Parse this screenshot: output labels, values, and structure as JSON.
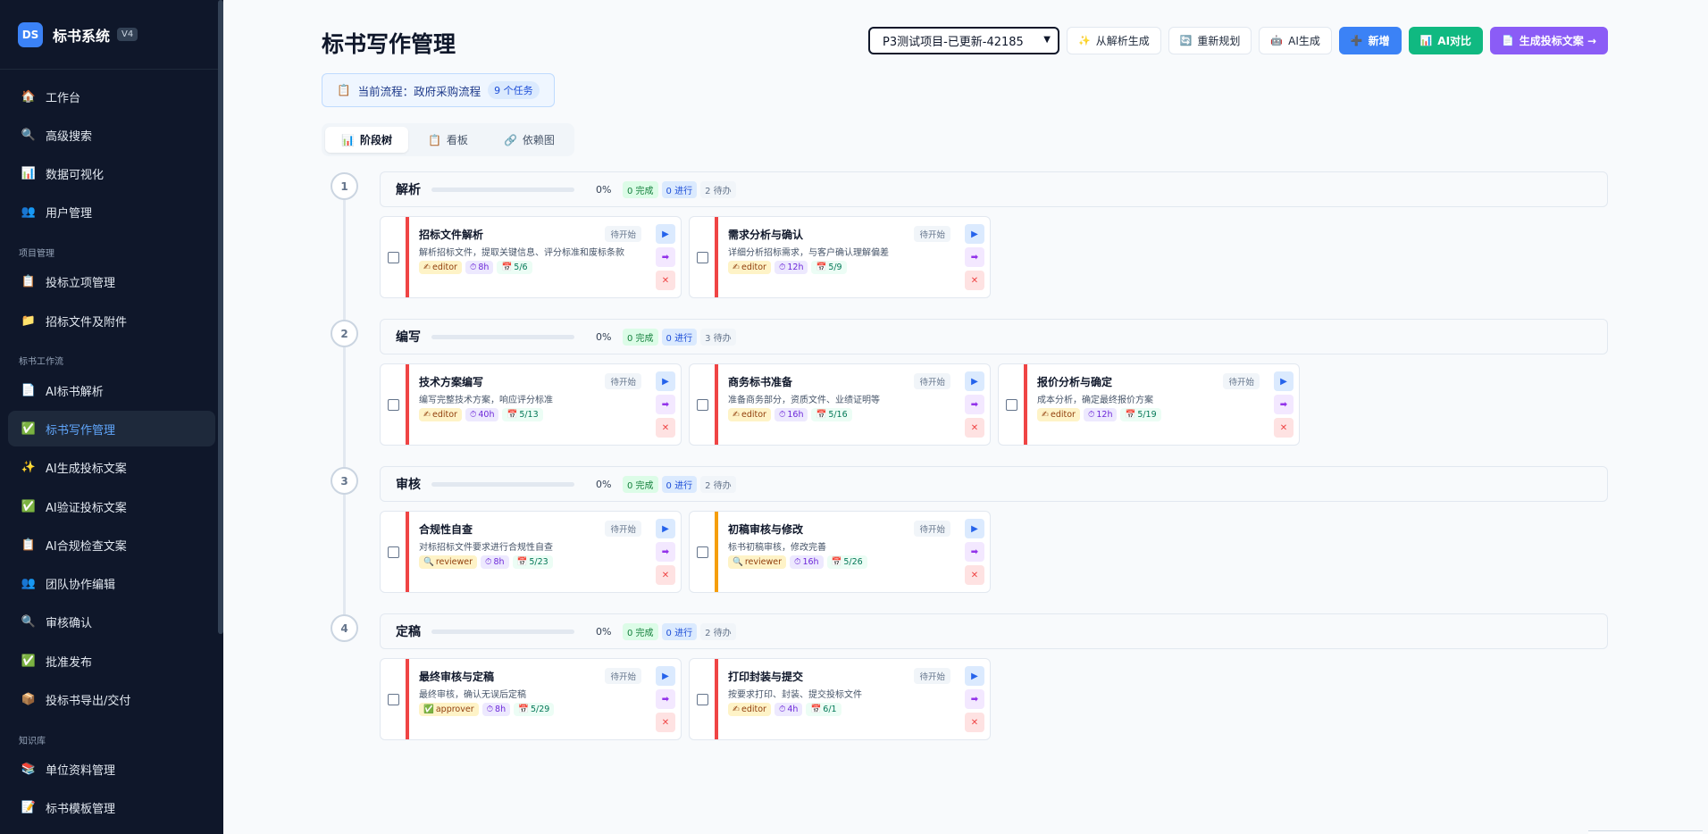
{
  "brand": {
    "logo": "DS",
    "title": "标书系统",
    "version": "V4"
  },
  "sidebar": {
    "groups": [
      {
        "label": "",
        "items": [
          {
            "label": "工作台",
            "icon": "house-icon",
            "glyph": "🏠",
            "active": false
          },
          {
            "label": "高级搜索",
            "icon": "search-icon",
            "glyph": "🔍",
            "active": false
          },
          {
            "label": "数据可视化",
            "icon": "chart-icon",
            "glyph": "📊",
            "active": false
          },
          {
            "label": "用户管理",
            "icon": "users-icon",
            "glyph": "👥",
            "active": false
          }
        ]
      },
      {
        "label": "项目管理",
        "items": [
          {
            "label": "投标立项管理",
            "icon": "clipboard-icon",
            "glyph": "📋",
            "active": false
          },
          {
            "label": "招标文件及附件",
            "icon": "folder-icon",
            "glyph": "📁",
            "active": false
          }
        ]
      },
      {
        "label": "标书工作流",
        "items": [
          {
            "label": "AI标书解析",
            "icon": "document-icon",
            "glyph": "📄",
            "active": false
          },
          {
            "label": "标书写作管理",
            "icon": "check-icon",
            "glyph": "✅",
            "active": true
          },
          {
            "label": "AI生成投标文案",
            "icon": "sparkles-icon",
            "glyph": "✨",
            "active": false
          },
          {
            "label": "AI验证投标文案",
            "icon": "check-icon",
            "glyph": "✅",
            "active": false
          },
          {
            "label": "AI合规检查文案",
            "icon": "clipboard-icon",
            "glyph": "📋",
            "active": false
          },
          {
            "label": "团队协作编辑",
            "icon": "users-icon",
            "glyph": "👥",
            "active": false
          },
          {
            "label": "审核确认",
            "icon": "search-icon",
            "glyph": "🔍",
            "active": false
          },
          {
            "label": "批准发布",
            "icon": "check-icon",
            "glyph": "✅",
            "active": false
          },
          {
            "label": "投标书导出/交付",
            "icon": "package-icon",
            "glyph": "📦",
            "active": false
          }
        ]
      },
      {
        "label": "知识库",
        "items": [
          {
            "label": "单位资料管理",
            "icon": "books-icon",
            "glyph": "📚",
            "active": false
          },
          {
            "label": "标书模板管理",
            "icon": "template-icon",
            "glyph": "📝",
            "active": false
          }
        ]
      }
    ]
  },
  "page": {
    "title": "标书写作管理"
  },
  "toolbar": {
    "project_value": "P3测试项目-已更新-42185",
    "buttons": [
      {
        "label": "从解析生成",
        "icon": "sparkles-icon",
        "glyph": "✨",
        "style": "plain",
        "name": "generate-from-parse-button"
      },
      {
        "label": "重新规划",
        "icon": "refresh-icon",
        "glyph": "🔄",
        "style": "plain",
        "name": "replan-button"
      },
      {
        "label": "AI生成",
        "icon": "robot-icon",
        "glyph": "🤖",
        "style": "plain",
        "name": "ai-generate-button"
      },
      {
        "label": "新增",
        "icon": "plus-icon",
        "glyph": "➕",
        "style": "blue",
        "name": "add-button"
      },
      {
        "label": "AI对比",
        "icon": "chart-icon",
        "glyph": "📊",
        "style": "green",
        "name": "ai-compare-button"
      },
      {
        "label": "生成投标文案 →",
        "icon": "document-icon",
        "glyph": "📄",
        "style": "purple",
        "name": "generate-bid-text-button"
      }
    ]
  },
  "flow": {
    "prefix": "当前流程：政府采购流程",
    "count": "9 个任务"
  },
  "view_tabs": [
    {
      "label": "阶段树",
      "icon": "chart-icon",
      "glyph": "📊",
      "active": true
    },
    {
      "label": "看板",
      "icon": "clipboard-icon",
      "glyph": "📋",
      "active": false
    },
    {
      "label": "依赖图",
      "icon": "link-icon",
      "glyph": "🔗",
      "active": false
    }
  ],
  "stages": [
    {
      "num": "1",
      "name": "解析",
      "pct": "0%",
      "done": "0 完成",
      "doing": "0 进行",
      "todo": "2 待办",
      "tasks": [
        {
          "title": "招标文件解析",
          "desc": "解析招标文件，提取关键信息、评分标准和废标条款",
          "role": "editor",
          "role_icon": "✍",
          "hours": "8h",
          "date": "5/6",
          "status": "待开始",
          "stripe": "red"
        },
        {
          "title": "需求分析与确认",
          "desc": "详细分析招标需求，与客户确认理解偏差",
          "role": "editor",
          "role_icon": "✍",
          "hours": "12h",
          "date": "5/9",
          "status": "待开始",
          "stripe": "red"
        }
      ]
    },
    {
      "num": "2",
      "name": "编写",
      "pct": "0%",
      "done": "0 完成",
      "doing": "0 进行",
      "todo": "3 待办",
      "tasks": [
        {
          "title": "技术方案编写",
          "desc": "编写完整技术方案，响应评分标准",
          "role": "editor",
          "role_icon": "✍",
          "hours": "40h",
          "date": "5/13",
          "status": "待开始",
          "stripe": "red"
        },
        {
          "title": "商务标书准备",
          "desc": "准备商务部分，资质文件、业绩证明等",
          "role": "editor",
          "role_icon": "✍",
          "hours": "16h",
          "date": "5/16",
          "status": "待开始",
          "stripe": "red"
        },
        {
          "title": "报价分析与确定",
          "desc": "成本分析，确定最终报价方案",
          "role": "editor",
          "role_icon": "✍",
          "hours": "12h",
          "date": "5/19",
          "status": "待开始",
          "stripe": "red"
        }
      ]
    },
    {
      "num": "3",
      "name": "审核",
      "pct": "0%",
      "done": "0 完成",
      "doing": "0 进行",
      "todo": "2 待办",
      "tasks": [
        {
          "title": "合规性自查",
          "desc": "对标招标文件要求进行合规性自查",
          "role": "reviewer",
          "role_icon": "🔍",
          "hours": "8h",
          "date": "5/23",
          "status": "待开始",
          "stripe": "red"
        },
        {
          "title": "初稿审核与修改",
          "desc": "标书初稿审核，修改完善",
          "role": "reviewer",
          "role_icon": "🔍",
          "hours": "16h",
          "date": "5/26",
          "status": "待开始",
          "stripe": "orange"
        }
      ]
    },
    {
      "num": "4",
      "name": "定稿",
      "pct": "0%",
      "done": "0 完成",
      "doing": "0 进行",
      "todo": "2 待办",
      "tasks": [
        {
          "title": "最终审核与定稿",
          "desc": "最终审核，确认无误后定稿",
          "role": "approver",
          "role_icon": "✅",
          "hours": "8h",
          "date": "5/29",
          "status": "待开始",
          "stripe": "red"
        },
        {
          "title": "打印封装与提交",
          "desc": "按要求打印、封装、提交投标文件",
          "role": "editor",
          "role_icon": "✍",
          "hours": "4h",
          "date": "6/1",
          "status": "待开始",
          "stripe": "red"
        }
      ]
    }
  ]
}
